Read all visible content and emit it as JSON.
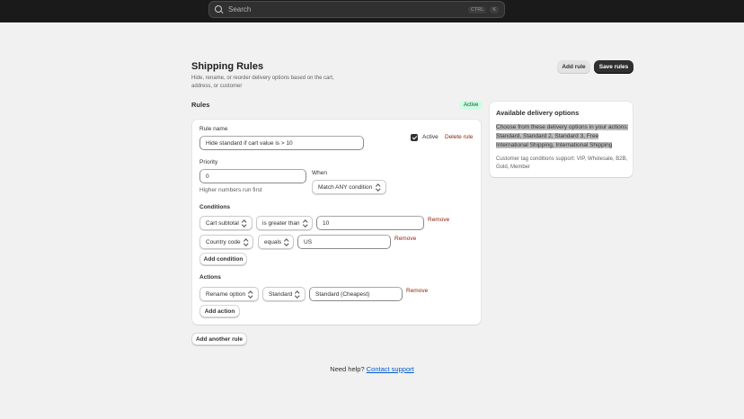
{
  "topbar": {
    "search_placeholder": "Search",
    "shortcut_ctrl": "CTRL",
    "shortcut_key": "K"
  },
  "page": {
    "title": "Shipping Rules",
    "subtitle": "Hide, rename, or reorder delivery options based on the cart, address, or customer",
    "add_rule_label": "Add rule",
    "save_rules_label": "Save rules"
  },
  "rules": {
    "heading": "Rules",
    "status_badge": "Active",
    "rule_name_label": "Rule name",
    "rule_name_value": "Hide standard if cart value is > 10",
    "active_label": "Active",
    "active_checked": true,
    "delete_label": "Delete rule",
    "priority_label": "Priority",
    "priority_value": "0",
    "priority_help": "Higher numbers run first",
    "when_label": "When",
    "when_value": "Match ANY condition",
    "conditions_heading": "Conditions",
    "conditions": [
      {
        "field": "Cart subtotal",
        "operator": "is greater than",
        "value": "10",
        "remove": "Remove"
      },
      {
        "field": "Country code",
        "operator": "equals",
        "value": "US",
        "remove": "Remove"
      }
    ],
    "add_condition_label": "Add condition",
    "actions_heading": "Actions",
    "actions": [
      {
        "type": "Rename option",
        "target": "Standard",
        "value": "Standard (Cheapest)",
        "remove": "Remove"
      }
    ],
    "add_action_label": "Add action",
    "add_another_rule_label": "Add another rule"
  },
  "sidebar": {
    "title": "Available delivery options",
    "options_text": "Choose from these delivery options in your actions: Standard, Standard 2, Standard 3, Free International Shipping, International Shipping",
    "note": "Customer tag conditions support: VIP, Wholesale, B2B, Gold, Member"
  },
  "footer": {
    "help_text": "Need help?",
    "link_text": "Contact support"
  },
  "colors": {
    "topbar": "#1a1a1a",
    "primary_button": "#303030",
    "badge_bg": "#cdfee1",
    "badge_text": "#0c5132",
    "destructive": "#8e1f0b",
    "link": "#005bd3"
  }
}
